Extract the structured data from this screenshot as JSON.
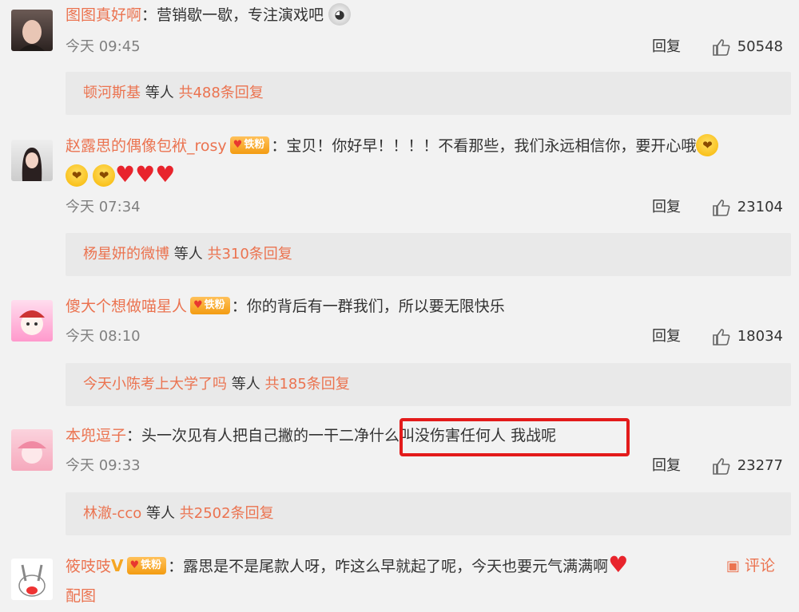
{
  "comments": [
    {
      "user": "图图真好啊",
      "text": "：营销歇一歇，专注演戏吧",
      "time": "今天 09:45",
      "reply_label": "回复",
      "likes": "50548",
      "replies": {
        "who": "顿河斯基",
        "mid": " 等人 ",
        "count": "共488条回复"
      }
    },
    {
      "user": "赵露思的偶像包袱_rosy",
      "badge": "铁粉",
      "text": "：宝贝！你好早！！！！不看那些，我们永远相信你，要开心哦",
      "time": "今天 07:34",
      "reply_label": "回复",
      "likes": "23104",
      "replies": {
        "who": "杨星妍的微博",
        "mid": " 等人 ",
        "count": "共310条回复"
      }
    },
    {
      "user": "傻大个想做喵星人",
      "badge": "铁粉",
      "text": "：你的背后有一群我们，所以要无限快乐",
      "time": "今天 08:10",
      "reply_label": "回复",
      "likes": "18034",
      "replies": {
        "who": "今天小陈考上大学了吗",
        "mid": " 等人 ",
        "count": "共185条回复"
      }
    },
    {
      "user": "本兜逗子",
      "text": "：头一次见有人把自己撇的一干二净",
      "text_highlight": "什么叫没伤害任何人 我战呢",
      "time": "今天 09:33",
      "reply_label": "回复",
      "likes": "23277",
      "replies": {
        "who": "林澈-cco",
        "mid": " 等人 ",
        "count": "共2502条回复"
      }
    },
    {
      "user": "筱吱吱",
      "badge": "铁粉",
      "text": "：露思是不是尾款人呀，咋这么早就起了呢，今天也要元气满满啊",
      "comment_label": "评论",
      "extra": "配图"
    }
  ],
  "colors": {
    "accent": "#eb7350",
    "highlight": "#e31b1b",
    "reply_bg": "#e9e9e9"
  }
}
